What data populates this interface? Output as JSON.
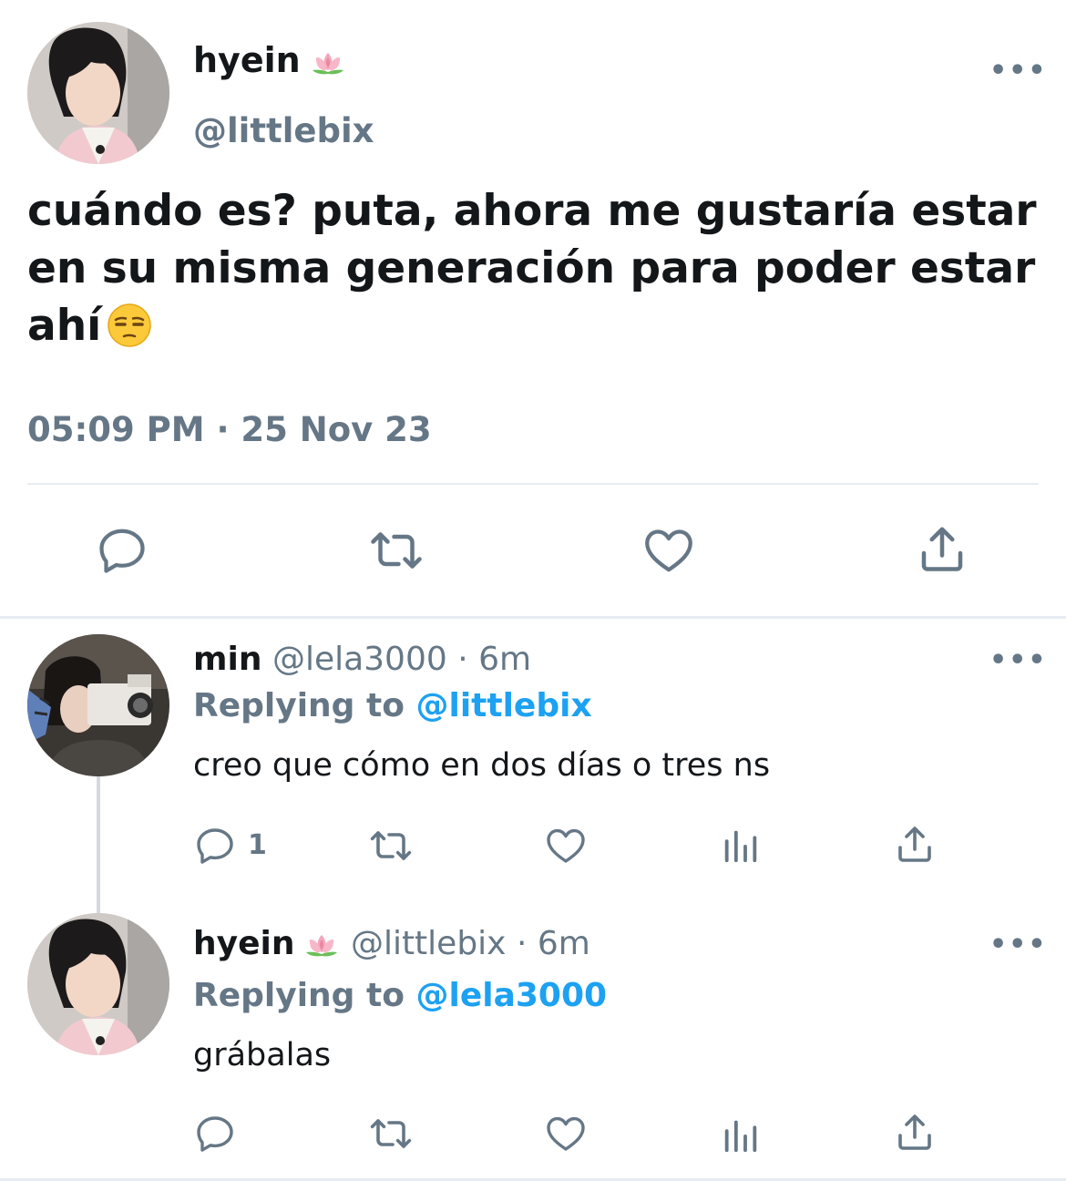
{
  "main_tweet": {
    "author_name": "hyein",
    "author_emoji": "lotus-emoji",
    "handle": "@littlebix",
    "text": "cuándo es? puta, ahora me gustaría estar en su misma generación para poder estar ahí",
    "text_emoji": "unamused-face-emoji",
    "timestamp": "05:09 PM · 25 Nov 23",
    "more": "•••",
    "actions": [
      "reply-icon",
      "retweet-icon",
      "like-icon",
      "share-icon"
    ]
  },
  "replies": [
    {
      "name": "min",
      "handle": "@lela3000",
      "sep": "·",
      "time": "6m",
      "replying_label": "Replying to",
      "replying_to": "@littlebix",
      "text": "creo que cómo en dos días o tres ns",
      "reply_count": "1",
      "more": "•••",
      "actions": [
        "reply-icon",
        "retweet-icon",
        "like-icon",
        "analytics-icon",
        "share-icon"
      ]
    },
    {
      "name": "hyein",
      "name_emoji": "lotus-emoji",
      "handle": "@littlebix",
      "sep": "·",
      "time": "6m",
      "replying_label": "Replying to",
      "replying_to": "@lela3000",
      "text": "grábalas",
      "more": "•••",
      "actions": [
        "reply-icon",
        "retweet-icon",
        "like-icon",
        "analytics-icon",
        "share-icon"
      ]
    }
  ],
  "colors": {
    "text": "#14171a",
    "secondary": "#657786",
    "accent": "#1da1f2",
    "divider": "#e6ecf0"
  }
}
